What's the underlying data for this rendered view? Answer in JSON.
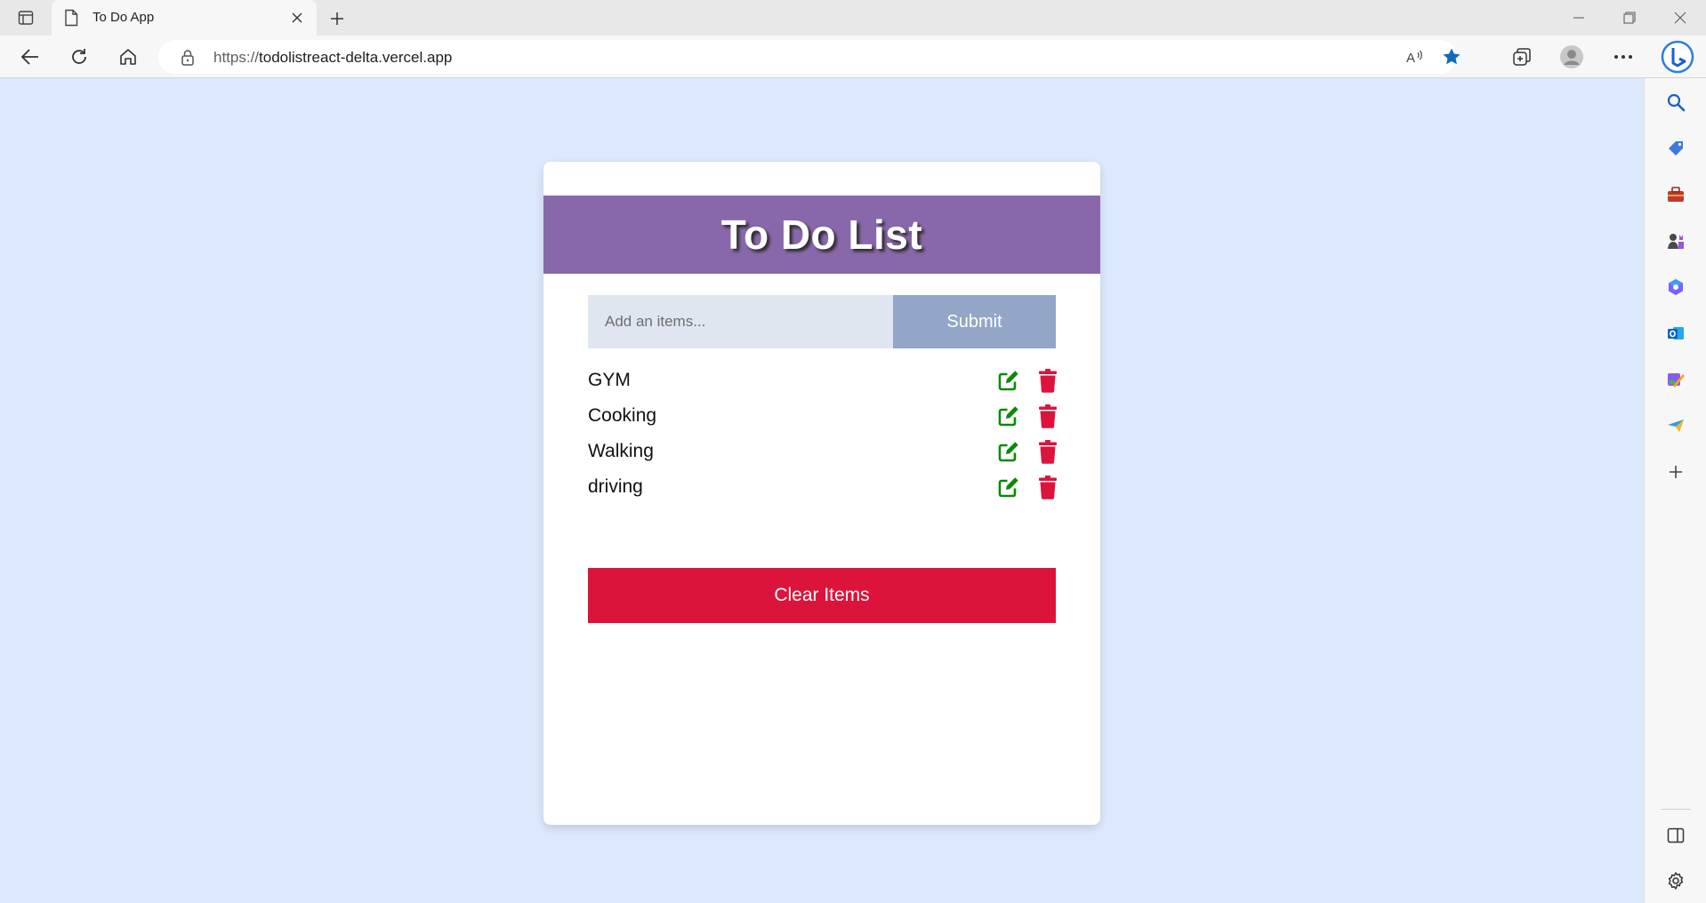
{
  "browser": {
    "tab_title": "To Do App",
    "url_protocol": "https://",
    "url_host": "todolistreact-delta.vercel.app",
    "icons": {
      "tab_actions": "tab-actions-icon",
      "favicon": "page-icon",
      "close_tab": "close-icon",
      "new_tab": "plus-icon",
      "back": "back-arrow-icon",
      "refresh": "refresh-icon",
      "home": "home-icon",
      "lock": "lock-icon",
      "read_aloud": "read-aloud-icon",
      "favorite": "star-icon",
      "collections": "collections-icon",
      "profile": "avatar-icon",
      "more": "more-icon",
      "copilot": "bing-icon"
    },
    "accent_color": "#0f6cbd"
  },
  "sidebar": {
    "icons": [
      "search-icon",
      "shopping-tag-icon",
      "tools-icon",
      "games-icon",
      "microsoft365-icon",
      "outlook-icon",
      "designer-icon",
      "send-icon",
      "add-icon",
      "split-screen-icon",
      "settings-icon"
    ]
  },
  "app": {
    "title": "To Do List",
    "input_placeholder": "Add an items...",
    "input_value": "",
    "submit_label": "Submit",
    "items": [
      {
        "label": "GYM"
      },
      {
        "label": "Cooking"
      },
      {
        "label": "Walking"
      },
      {
        "label": "driving"
      }
    ],
    "clear_label": "Clear Items",
    "colors": {
      "background": "#dce8fb",
      "header": "#8868aa",
      "submit": "#93a6c8",
      "input": "#e0e6f0",
      "edit_icon": "#098a09",
      "delete_icon": "#dc143c",
      "clear_button": "#dc143c"
    }
  }
}
